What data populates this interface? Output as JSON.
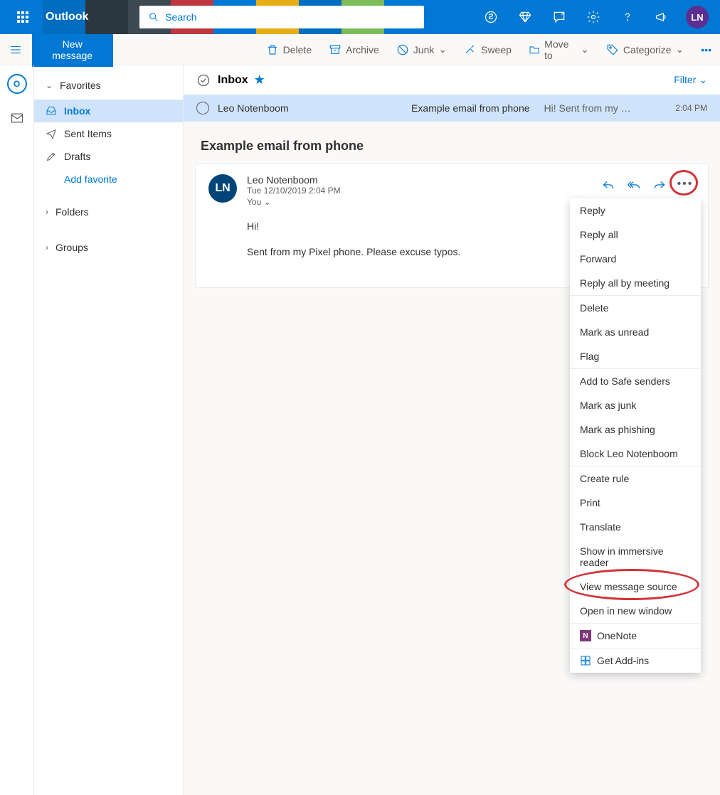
{
  "brand": "Outlook",
  "search_placeholder": "Search",
  "avatar_initials": "LN",
  "new_message": "New message",
  "commands": {
    "delete": "Delete",
    "archive": "Archive",
    "junk": "Junk",
    "sweep": "Sweep",
    "move_to": "Move to",
    "categorize": "Categorize"
  },
  "sidebar": {
    "favorites": "Favorites",
    "inbox": "Inbox",
    "sent": "Sent Items",
    "drafts": "Drafts",
    "add_favorite": "Add favorite",
    "folders": "Folders",
    "groups": "Groups"
  },
  "list": {
    "title": "Inbox",
    "filter": "Filter",
    "messages": [
      {
        "from": "Leo Notenboom",
        "subject": "Example email from phone",
        "preview": "Hi! Sent from my …",
        "time": "2:04 PM"
      }
    ]
  },
  "reader": {
    "subject": "Example email from phone",
    "sender_initials": "LN",
    "sender_name": "Leo Notenboom",
    "date": "Tue 12/10/2019 2:04 PM",
    "to_label": "You",
    "body_line1": "Hi!",
    "body_line2": "Sent from my Pixel phone. Please excuse typos."
  },
  "context_menu": [
    "Reply",
    "Reply all",
    "Forward",
    "Reply all by meeting",
    "Delete",
    "Mark as unread",
    "Flag",
    "Add to Safe senders",
    "Mark as junk",
    "Mark as phishing",
    "Block Leo Notenboom",
    "Create rule",
    "Print",
    "Translate",
    "Show in immersive reader",
    "View message source",
    "Open in new window",
    "OneNote",
    "Get Add-ins"
  ]
}
